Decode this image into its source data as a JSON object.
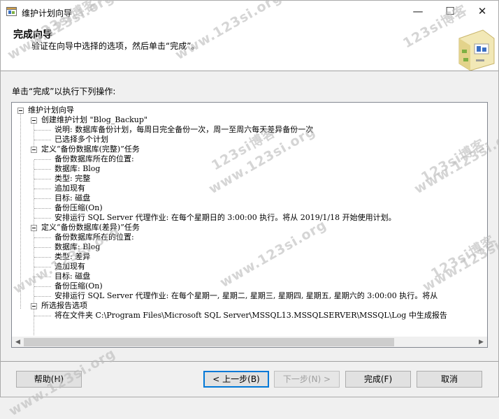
{
  "window": {
    "title": "维护计划向导",
    "controls": {
      "minimize": "—",
      "maximize": "☐",
      "close": "✕"
    }
  },
  "header": {
    "title": "完成向导",
    "subtitle": "验证在向导中选择的选项，然后单击“完成”。"
  },
  "instruction": "单击“完成”以执行下列操作:",
  "tree": [
    "维护计划向导",
    "创建维护计划 \"Blog_Backup\"",
    "说明: 数据库备份计划，每周日完全备份一次，周一至周六每天差异备份一次",
    "已选择多个计划",
    "定义“备份数据库(完整)”任务",
    "备份数据库所在的位置:",
    "数据库: Blog",
    "类型: 完整",
    "追加现有",
    "目标: 磁盘",
    "备份压缩(On)",
    "安排运行 SQL Server 代理作业: 在每个星期日的 3:00:00 执行。将从 2019/1/18 开始使用计划。",
    "定义“备份数据库(差异)”任务",
    "备份数据库所在的位置:",
    "数据库: Blog",
    "类型: 差异",
    "追加现有",
    "目标: 磁盘",
    "备份压缩(On)",
    "安排运行 SQL Server 代理作业: 在每个星期一, 星期二, 星期三, 星期四, 星期五, 星期六的 3:00:00 执行。将从",
    "所选报告选项",
    "将在文件夹 C:\\Program Files\\Microsoft SQL Server\\MSSQL13.MSSQLSERVER\\MSSQL\\Log 中生成报告"
  ],
  "scrollbar": {
    "left_arrow": "◀",
    "right_arrow": "▶"
  },
  "buttons": {
    "help": "帮助(H)",
    "back": "< 上一步(B)",
    "next": "下一步(N) >",
    "finish": "完成(F)",
    "cancel": "取消"
  },
  "watermark": {
    "text_cn": "123si博客",
    "text_url": "www.123si.org"
  }
}
